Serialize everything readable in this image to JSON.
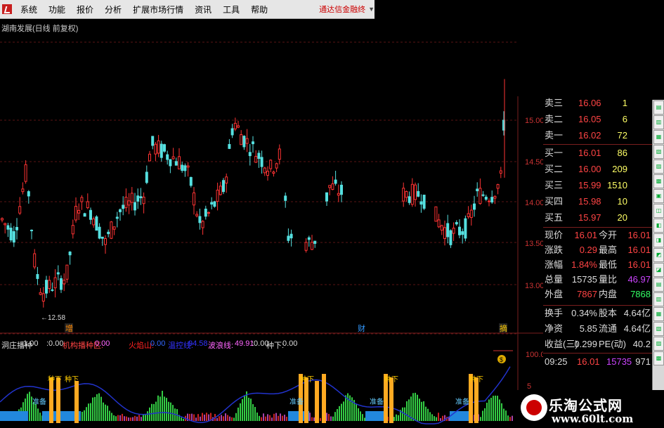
{
  "menu": {
    "items": [
      "系统",
      "功能",
      "报价",
      "分析",
      "扩展市场行情",
      "资讯",
      "工具",
      "帮助"
    ],
    "brand": "通达信金融终"
  },
  "title": "湖南发展(日线 前复权)",
  "price_axis": [
    "15.00",
    "14.50",
    "14.00",
    "13.50",
    "13.00"
  ],
  "low_label": "←12.58",
  "bottom_markers": [
    "增",
    "财",
    "摘"
  ],
  "indicator": {
    "name": "洞庄播种",
    "items": [
      {
        "text": ":1.00",
        "color": "#dddddd"
      },
      {
        "text": ":0.00",
        "color": "#dddddd"
      },
      {
        "text": "机构播种区:",
        "color": "#ff4444"
      },
      {
        "text": "0.00",
        "color": "#ff66ff"
      },
      {
        "text": "火焰山:",
        "color": "#ff2222"
      },
      {
        "text": "0.00",
        "color": "#3366ff"
      },
      {
        "text": "温控线:",
        "color": "#3333ff"
      },
      {
        "text": "94.58",
        "color": "#3333ff"
      },
      {
        "text": "波浪线:",
        "color": "#ff66ff"
      },
      {
        "text": "49.91",
        "color": "#ff66ff"
      },
      {
        "text": ":0.00",
        "color": "#dddddd"
      },
      {
        "text": "种下:",
        "color": "#dddddd"
      },
      {
        "text": "0.00",
        "color": "#dddddd"
      }
    ],
    "axis": [
      "100.0",
      "5"
    ],
    "labels": [
      "种下",
      "种下",
      "种下",
      "种下",
      "种下"
    ],
    "zone_labels": [
      "准备",
      "准备",
      "准备",
      "准备"
    ]
  },
  "panel": {
    "sell": [
      {
        "label": "卖三",
        "price": "16.06",
        "vol": "1"
      },
      {
        "label": "卖二",
        "price": "16.05",
        "vol": "6"
      },
      {
        "label": "卖一",
        "price": "16.02",
        "vol": "72"
      }
    ],
    "buy": [
      {
        "label": "买一",
        "price": "16.01",
        "vol": "86"
      },
      {
        "label": "买二",
        "price": "16.00",
        "vol": "209"
      },
      {
        "label": "买三",
        "price": "15.99",
        "vol": "1510"
      },
      {
        "label": "买四",
        "price": "15.98",
        "vol": "10"
      },
      {
        "label": "买五",
        "price": "15.97",
        "vol": "20"
      }
    ],
    "stats": [
      {
        "l1": "现价",
        "v1": "16.01",
        "l2": "今开",
        "v2": "16.01",
        "c1": "#ff4444",
        "c2": "#ff4444"
      },
      {
        "l1": "涨跌",
        "v1": "0.29",
        "l2": "最高",
        "v2": "16.01",
        "c1": "#ff4444",
        "c2": "#ff4444"
      },
      {
        "l1": "涨幅",
        "v1": "1.84%",
        "l2": "最低",
        "v2": "16.01",
        "c1": "#ff4444",
        "c2": "#ff4444"
      },
      {
        "l1": "总量",
        "v1": "15735",
        "l2": "量比",
        "v2": "46.97",
        "c1": "#dddddd",
        "c2": "#cc44ff"
      },
      {
        "l1": "外盘",
        "v1": "7867",
        "l2": "内盘",
        "v2": "7868",
        "c1": "#ff4444",
        "c2": "#33ff66"
      }
    ],
    "stats2": [
      {
        "l1": "换手",
        "v1": "0.34%",
        "l2": "股本",
        "v2": "4.64亿"
      },
      {
        "l1": "净资",
        "v1": "5.85",
        "l2": "流通",
        "v2": "4.64亿"
      },
      {
        "l1": "收益(三)",
        "v1": "0.299",
        "l2": "PE(动)",
        "v2": "40.2"
      }
    ],
    "tick": {
      "time": "09:25",
      "price": "16.01",
      "vol": "15735",
      "extra": "971"
    }
  },
  "watermark": {
    "line1": "乐淘公式网",
    "line2": "www.60lt.com"
  }
}
